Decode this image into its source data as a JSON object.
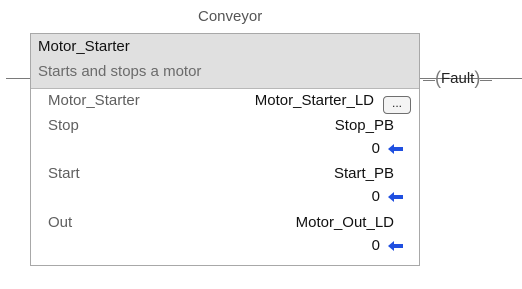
{
  "rung": {
    "tag_label": "Conveyor"
  },
  "block": {
    "name": "Motor_Starter",
    "description": "Starts and stops a motor",
    "rows": [
      {
        "label": "Motor_Starter",
        "tag": "Motor_Starter_LD",
        "value": ""
      },
      {
        "label": "Stop",
        "tag": "Stop_PB",
        "value": "0"
      },
      {
        "label": "Start",
        "tag": "Start_PB",
        "value": "0"
      },
      {
        "label": "Out",
        "tag": "Motor_Out_LD",
        "value": "0"
      }
    ],
    "ellipsis_label": "...",
    "arrow_color": "#1f4fe0",
    "arrow_icon": "arrow-left-icon"
  },
  "coil": {
    "label": "Fault",
    "open_paren": "(",
    "close_paren": ")"
  }
}
